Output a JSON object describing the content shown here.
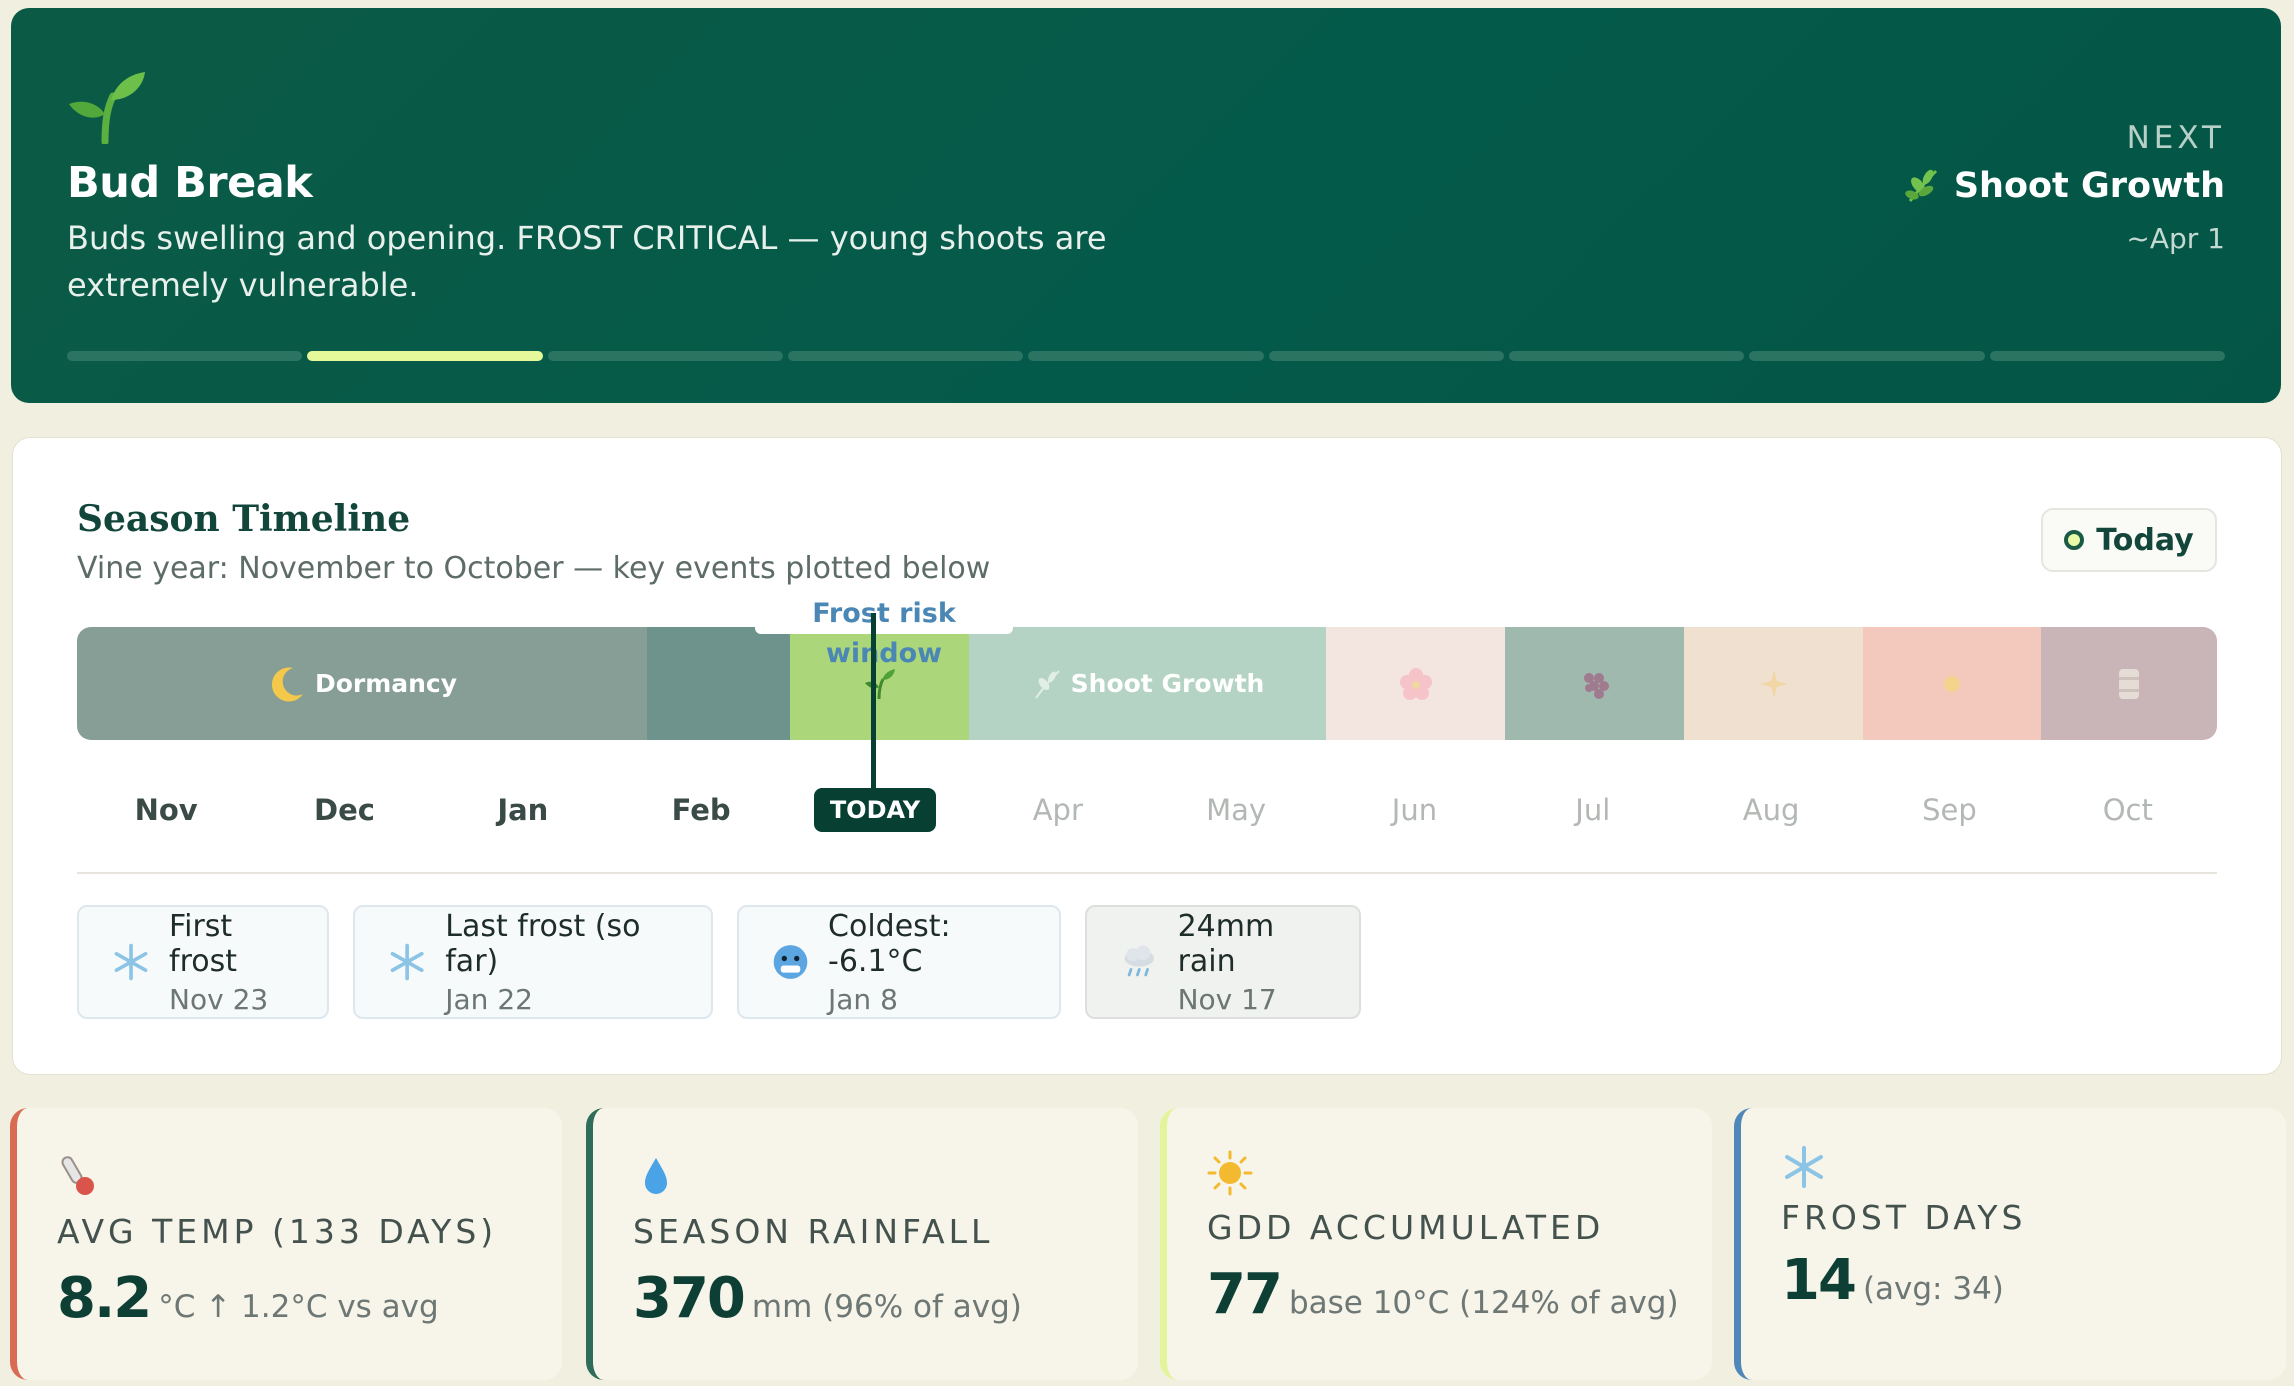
{
  "hero": {
    "title": "Bud Break",
    "description": "Buds swelling and opening. FROST CRITICAL — young shoots are extremely vulnerable.",
    "next_label": "NEXT",
    "next_phase": "Shoot Growth",
    "next_date": "~Apr 1",
    "progress_segments": 9,
    "progress_active_index": 1,
    "icon": "seedling-icon"
  },
  "timeline": {
    "title": "Season Timeline",
    "subtitle": "Vine year: November to October — key events plotted below",
    "today_button": "Today",
    "frost_window_label": "Frost risk window",
    "today_tag": "TODAY",
    "phases": {
      "dormancy": "Dormancy",
      "shoot_growth": "Shoot Growth"
    },
    "months": [
      "Nov",
      "Dec",
      "Jan",
      "Feb",
      "Mar",
      "Apr",
      "May",
      "Jun",
      "Jul",
      "Aug",
      "Sep",
      "Oct"
    ],
    "current_month_index": 4
  },
  "events": [
    {
      "title": "First frost",
      "date": "Nov 23",
      "icon": "snowflake-icon"
    },
    {
      "title": "Last frost (so far)",
      "date": "Jan 22",
      "icon": "snowflake-icon"
    },
    {
      "title": "Coldest: -6.1°C",
      "date": "Jan 8",
      "icon": "cold-face-icon"
    },
    {
      "title": "24mm rain",
      "date": "Nov 17",
      "icon": "rain-cloud-icon"
    }
  ],
  "stats": [
    {
      "label": "AVG TEMP (133 DAYS)",
      "value": "8.2",
      "unit": "°C ↑ 1.2°C vs avg",
      "icon": "thermometer-icon",
      "accent": "#d96b55"
    },
    {
      "label": "SEASON RAINFALL",
      "value": "370",
      "unit": "mm (96% of avg)",
      "icon": "droplet-icon",
      "accent": "#2f6d5a"
    },
    {
      "label": "GDD ACCUMULATED",
      "value": "77",
      "unit": "base 10°C (124% of avg)",
      "icon": "sun-icon",
      "accent": "#e3f59a"
    },
    {
      "label": "FROST DAYS",
      "value": "14",
      "unit": "(avg: 34)",
      "icon": "snowflake-icon",
      "accent": "#4f88b8"
    }
  ]
}
